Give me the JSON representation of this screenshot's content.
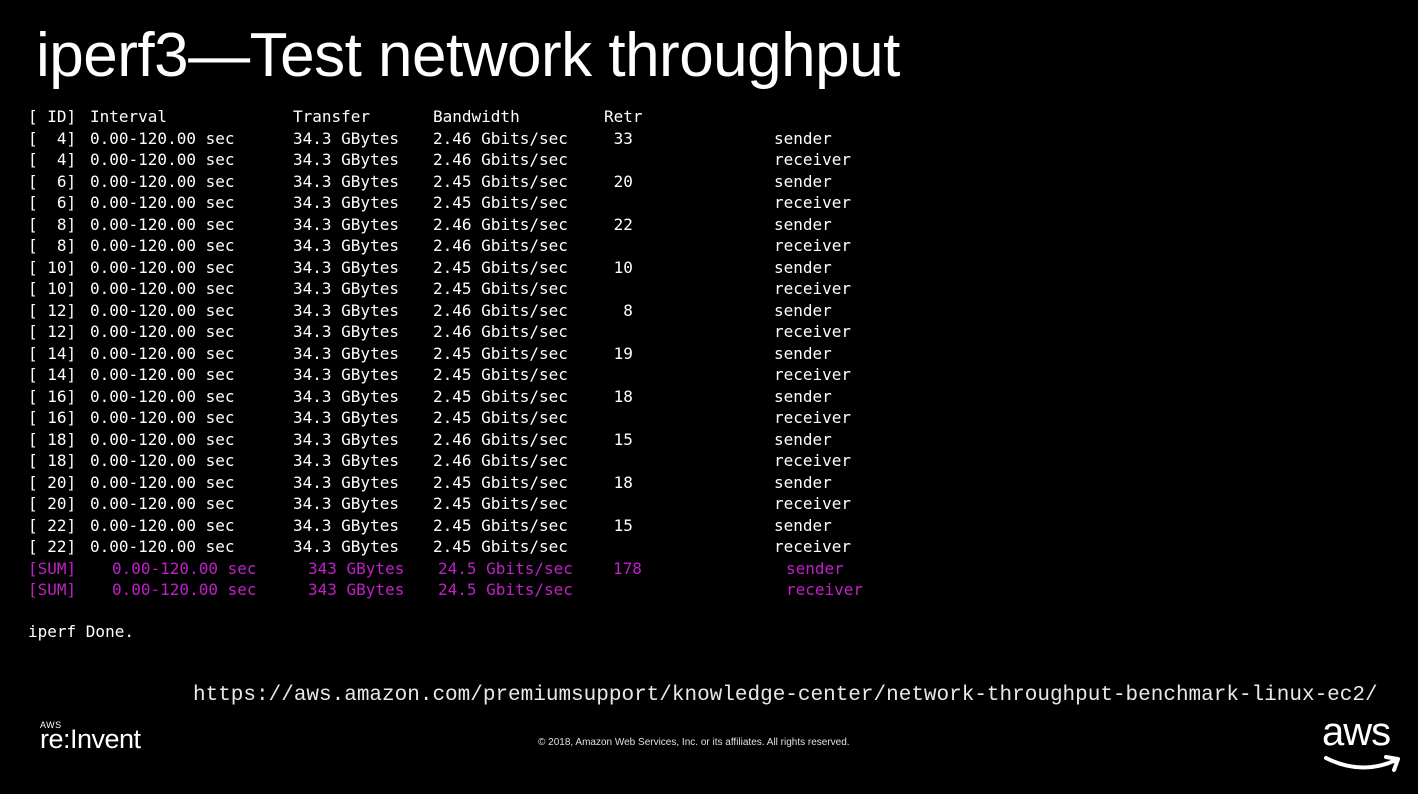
{
  "title": "iperf3—Test network throughput",
  "header": {
    "id": "[ ID]",
    "interval": "Interval",
    "transfer": "Transfer",
    "bandwidth": "Bandwidth",
    "retr": "Retr"
  },
  "rows": [
    {
      "id": "[  4]",
      "interval": "0.00-120.00 sec",
      "transfer": "34.3 GBytes",
      "bandwidth": "2.46 Gbits/sec",
      "retr": " 33",
      "role": "sender"
    },
    {
      "id": "[  4]",
      "interval": "0.00-120.00 sec",
      "transfer": "34.3 GBytes",
      "bandwidth": "2.46 Gbits/sec",
      "retr": "",
      "role": "receiver"
    },
    {
      "id": "[  6]",
      "interval": "0.00-120.00 sec",
      "transfer": "34.3 GBytes",
      "bandwidth": "2.45 Gbits/sec",
      "retr": " 20",
      "role": "sender"
    },
    {
      "id": "[  6]",
      "interval": "0.00-120.00 sec",
      "transfer": "34.3 GBytes",
      "bandwidth": "2.45 Gbits/sec",
      "retr": "",
      "role": "receiver"
    },
    {
      "id": "[  8]",
      "interval": "0.00-120.00 sec",
      "transfer": "34.3 GBytes",
      "bandwidth": "2.46 Gbits/sec",
      "retr": " 22",
      "role": "sender"
    },
    {
      "id": "[  8]",
      "interval": "0.00-120.00 sec",
      "transfer": "34.3 GBytes",
      "bandwidth": "2.46 Gbits/sec",
      "retr": "",
      "role": "receiver"
    },
    {
      "id": "[ 10]",
      "interval": "0.00-120.00 sec",
      "transfer": "34.3 GBytes",
      "bandwidth": "2.45 Gbits/sec",
      "retr": " 10",
      "role": "sender"
    },
    {
      "id": "[ 10]",
      "interval": "0.00-120.00 sec",
      "transfer": "34.3 GBytes",
      "bandwidth": "2.45 Gbits/sec",
      "retr": "",
      "role": "receiver"
    },
    {
      "id": "[ 12]",
      "interval": "0.00-120.00 sec",
      "transfer": "34.3 GBytes",
      "bandwidth": "2.46 Gbits/sec",
      "retr": "  8",
      "role": "sender"
    },
    {
      "id": "[ 12]",
      "interval": "0.00-120.00 sec",
      "transfer": "34.3 GBytes",
      "bandwidth": "2.46 Gbits/sec",
      "retr": "",
      "role": "receiver"
    },
    {
      "id": "[ 14]",
      "interval": "0.00-120.00 sec",
      "transfer": "34.3 GBytes",
      "bandwidth": "2.45 Gbits/sec",
      "retr": " 19",
      "role": "sender"
    },
    {
      "id": "[ 14]",
      "interval": "0.00-120.00 sec",
      "transfer": "34.3 GBytes",
      "bandwidth": "2.45 Gbits/sec",
      "retr": "",
      "role": "receiver"
    },
    {
      "id": "[ 16]",
      "interval": "0.00-120.00 sec",
      "transfer": "34.3 GBytes",
      "bandwidth": "2.45 Gbits/sec",
      "retr": " 18",
      "role": "sender"
    },
    {
      "id": "[ 16]",
      "interval": "0.00-120.00 sec",
      "transfer": "34.3 GBytes",
      "bandwidth": "2.45 Gbits/sec",
      "retr": "",
      "role": "receiver"
    },
    {
      "id": "[ 18]",
      "interval": "0.00-120.00 sec",
      "transfer": "34.3 GBytes",
      "bandwidth": "2.46 Gbits/sec",
      "retr": " 15",
      "role": "sender"
    },
    {
      "id": "[ 18]",
      "interval": "0.00-120.00 sec",
      "transfer": "34.3 GBytes",
      "bandwidth": "2.46 Gbits/sec",
      "retr": "",
      "role": "receiver"
    },
    {
      "id": "[ 20]",
      "interval": "0.00-120.00 sec",
      "transfer": "34.3 GBytes",
      "bandwidth": "2.45 Gbits/sec",
      "retr": " 18",
      "role": "sender"
    },
    {
      "id": "[ 20]",
      "interval": "0.00-120.00 sec",
      "transfer": "34.3 GBytes",
      "bandwidth": "2.45 Gbits/sec",
      "retr": "",
      "role": "receiver"
    },
    {
      "id": "[ 22]",
      "interval": "0.00-120.00 sec",
      "transfer": "34.3 GBytes",
      "bandwidth": "2.45 Gbits/sec",
      "retr": " 15",
      "role": "sender"
    },
    {
      "id": "[ 22]",
      "interval": "0.00-120.00 sec",
      "transfer": "34.3 GBytes",
      "bandwidth": "2.45 Gbits/sec",
      "retr": "",
      "role": "receiver"
    }
  ],
  "sum_rows": [
    {
      "id": "[SUM]",
      "interval": "0.00-120.00 sec",
      "transfer": "343 GBytes",
      "bandwidth": "24.5 Gbits/sec",
      "retr": "178",
      "role": "sender"
    },
    {
      "id": "[SUM]",
      "interval": "0.00-120.00 sec",
      "transfer": "343 GBytes",
      "bandwidth": "24.5 Gbits/sec",
      "retr": "",
      "role": "receiver"
    }
  ],
  "done_text": "iperf Done.",
  "url": "https://aws.amazon.com/premiumsupport/knowledge-center/network-throughput-benchmark-linux-ec2/",
  "footer": {
    "reinvent_small": "AWS",
    "reinvent_logo": "re:Invent",
    "copyright": "© 2018, Amazon Web Services, Inc. or its affiliates. All rights reserved.",
    "aws_logo": "aws"
  },
  "colors": {
    "background": "#000000",
    "text": "#ffffff",
    "sum_highlight": "#c020c8",
    "aws_smile": "#ffffff"
  }
}
